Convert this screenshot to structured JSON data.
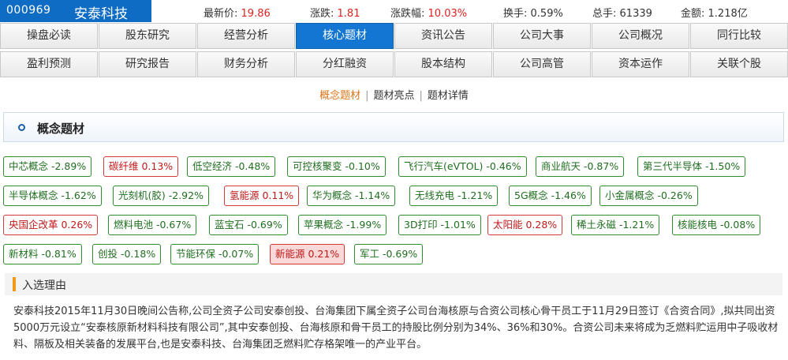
{
  "stock": {
    "code": "000969",
    "name": "安泰科技"
  },
  "stats": [
    {
      "label": "最新价:",
      "value": "19.86",
      "color": "red"
    },
    {
      "label": "涨跌:",
      "value": "1.81",
      "color": "red"
    },
    {
      "label": "涨跌幅:",
      "value": "10.03%",
      "color": "red"
    },
    {
      "label": "换手:",
      "value": "0.59%",
      "color": "normal"
    },
    {
      "label": "总手:",
      "value": "61339",
      "color": "normal"
    },
    {
      "label": "金额:",
      "value": "1.218亿",
      "color": "normal"
    }
  ],
  "nav": {
    "row1": [
      "操盘必读",
      "股东研究",
      "经营分析",
      "核心题材",
      "资讯公告",
      "公司大事",
      "公司概况",
      "同行比较"
    ],
    "row2": [
      "盈利预测",
      "研究报告",
      "财务分析",
      "分红融资",
      "股本结构",
      "公司高管",
      "资本运作",
      "关联个股"
    ],
    "active": "核心题材"
  },
  "subtabs": {
    "items": [
      "概念题材",
      "题材亮点",
      "题材详情"
    ],
    "selected": "概念题材",
    "separator": "|"
  },
  "section": {
    "title": "概念题材"
  },
  "tags": [
    {
      "text": "中芯概念 -2.89%",
      "style": "green"
    },
    {
      "text": "碳纤维 0.13%",
      "style": "red"
    },
    {
      "text": "低空经济 -0.48%",
      "style": "green"
    },
    {
      "text": "可控核聚变 -0.10%",
      "style": "green"
    },
    {
      "text": "飞行汽车(eVTOL) -0.46%",
      "style": "green"
    },
    {
      "text": "商业航天 -0.87%",
      "style": "green"
    },
    {
      "text": "第三代半导体 -1.50%",
      "style": "green"
    },
    {
      "text": "半导体概念 -1.62%",
      "style": "green"
    },
    {
      "text": "光刻机(胶) -2.92%",
      "style": "green"
    },
    {
      "text": "氢能源 0.11%",
      "style": "red"
    },
    {
      "text": "华为概念 -1.14%",
      "style": "green"
    },
    {
      "text": "无线充电 -1.21%",
      "style": "green"
    },
    {
      "text": "5G概念 -1.46%",
      "style": "green"
    },
    {
      "text": "小金属概念 -0.26%",
      "style": "green"
    },
    {
      "text": "央国企改革 0.26%",
      "style": "red"
    },
    {
      "text": "燃料电池 -0.67%",
      "style": "green"
    },
    {
      "text": "蓝宝石 -0.69%",
      "style": "green"
    },
    {
      "text": "苹果概念 -1.99%",
      "style": "green"
    },
    {
      "text": "3D打印 -1.01%",
      "style": "green"
    },
    {
      "text": "太阳能 0.28%",
      "style": "red"
    },
    {
      "text": "稀土永磁 -1.21%",
      "style": "green"
    },
    {
      "text": "核能核电 -0.08%",
      "style": "green"
    },
    {
      "text": "新材料 -0.81%",
      "style": "green"
    },
    {
      "text": "创投 -0.18%",
      "style": "green"
    },
    {
      "text": "节能环保 -0.07%",
      "style": "green"
    },
    {
      "text": "新能源 0.21%",
      "style": "red-filled"
    },
    {
      "text": "军工 -0.69%",
      "style": "green"
    }
  ],
  "reason": {
    "label": "入选理由",
    "text": "安泰科技2015年11月30日晚间公告称,公司全资子公司安泰创投、台海集团下属全资子公司台海核原与合资公司核心骨干员工于11月29日签订《合资合同》,拟共同出资5000万元设立“安泰核原新材料科技有限公司”,其中安泰创投、台海核原和骨干员工的持股比例分别为34%、36%和30%。合资公司未来将成为乏燃料贮运用中子吸收材料、隔板及相关装备的发展平台,也是安泰科技、台海集团乏燃料贮存格架唯一的产业平台。"
  },
  "colors": {
    "brand": "#0f6cc4",
    "active_tab": "#1276d2",
    "up": "#e02020",
    "down": "#1f6f1f",
    "accent": "#f09a1a"
  }
}
